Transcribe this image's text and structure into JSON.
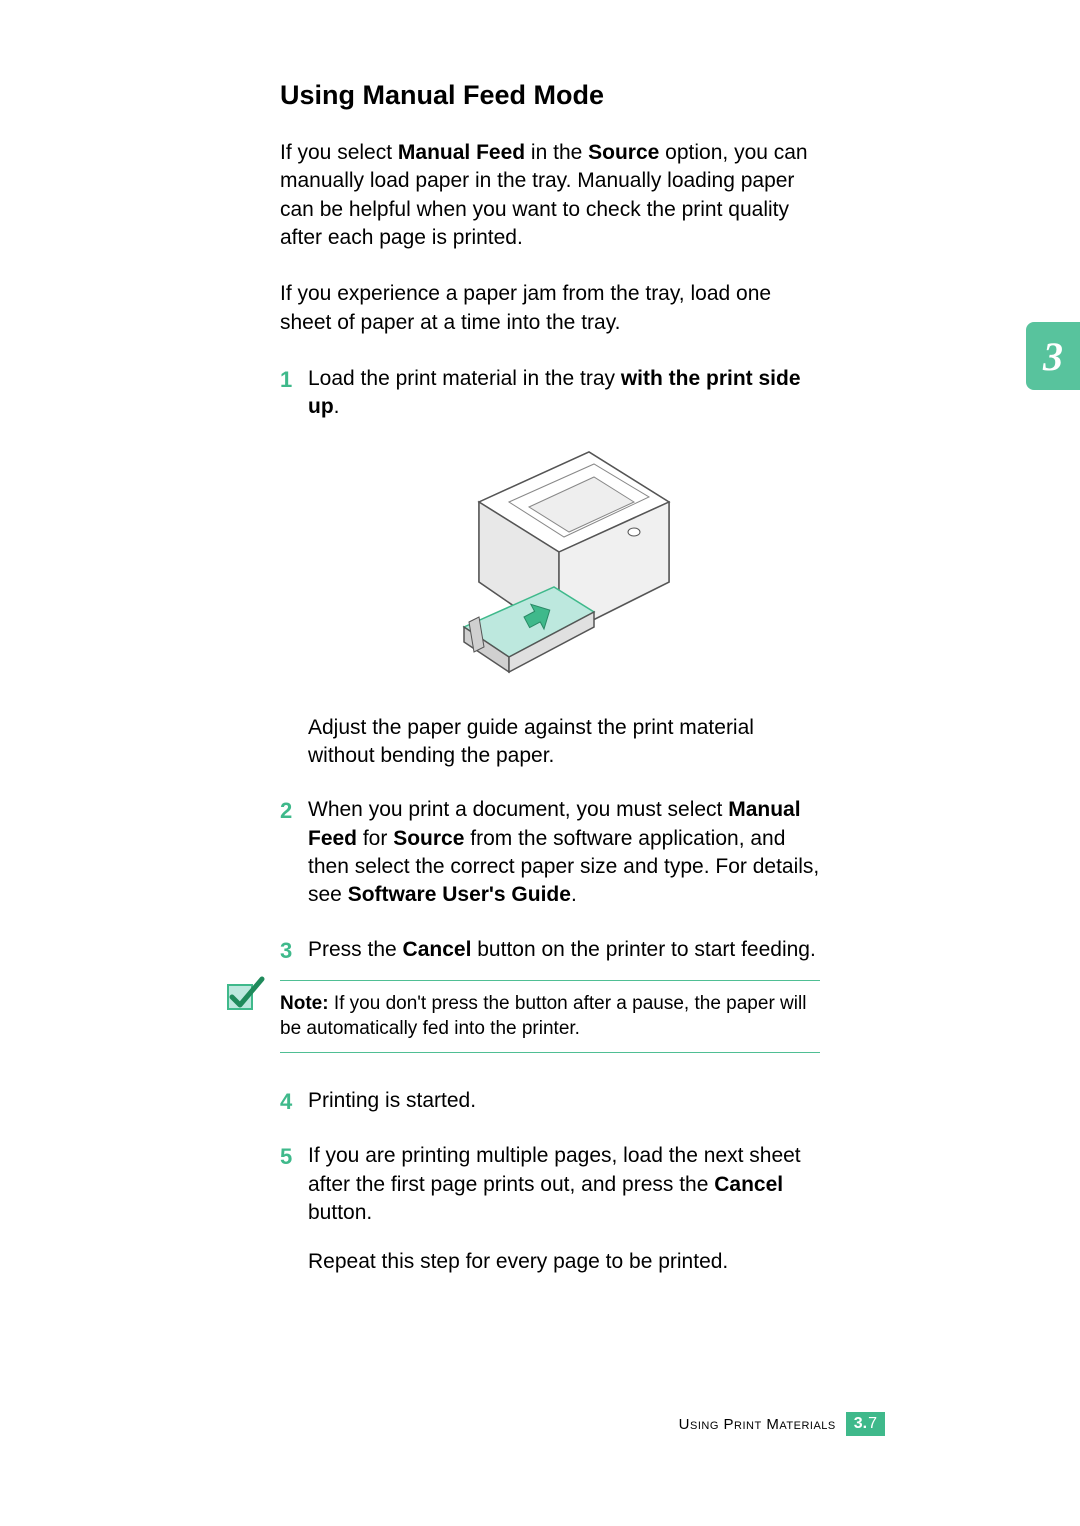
{
  "heading": "Using Manual Feed Mode",
  "intro1_a": "If you select ",
  "intro1_b": "Manual Feed",
  "intro1_c": " in the ",
  "intro1_d": "Source",
  "intro1_e": " option, you can manually load paper in the tray. Manually loading paper can be helpful when you want to check the print quality after each page is printed.",
  "intro2": "If you experience a paper jam from the tray, load one sheet of paper at a time into the tray.",
  "step1_num": "1",
  "step1_a": "Load the print material in the tray ",
  "step1_b": "with the print side up",
  "step1_c": ".",
  "step1_sub": "Adjust the paper guide against the print material without bending the paper.",
  "step2_num": "2",
  "step2_a": "When you print a document, you must select ",
  "step2_b": "Manual Feed",
  "step2_c": " for ",
  "step2_d": "Source",
  "step2_e": " from the software application, and then select the correct paper size and type. For details, see ",
  "step2_f": "Software User's Guide",
  "step2_g": ".",
  "step3_num": "3",
  "step3_a": "Press the ",
  "step3_b": "Cancel",
  "step3_c": " button on the printer to start feeding.",
  "note_label": "Note:",
  "note_text": " If you don't press the button after a pause, the paper will be automatically fed into the printer.",
  "step4_num": "4",
  "step4_text": "Printing is started.",
  "step5_num": "5",
  "step5_a": "If you are printing multiple pages, load the next sheet after the first page prints out, and press the ",
  "step5_b": "Cancel",
  "step5_c": " button.",
  "step5_sub": "Repeat this step for every page to be printed.",
  "chapter_tab": "3",
  "footer_label": "Using Print Materials",
  "footer_chapter": "3.",
  "footer_page": "7"
}
